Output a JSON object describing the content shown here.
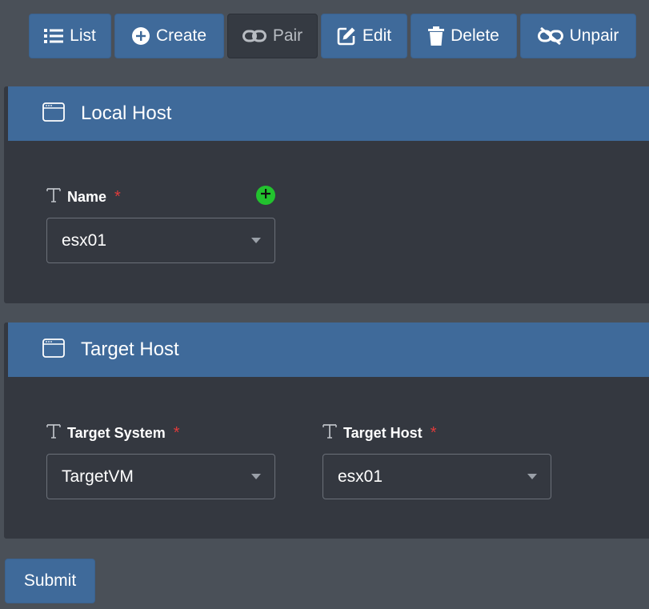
{
  "toolbar": {
    "list_label": "List",
    "create_label": "Create",
    "pair_label": "Pair",
    "edit_label": "Edit",
    "delete_label": "Delete",
    "unpair_label": "Unpair"
  },
  "local_host": {
    "title": "Local Host",
    "name_label": "Name",
    "name_required": "*",
    "name_value": "esx01"
  },
  "target_host": {
    "title": "Target Host",
    "system_label": "Target System",
    "system_required": "*",
    "system_value": "TargetVM",
    "host_label": "Target Host",
    "host_required": "*",
    "host_value": "esx01"
  },
  "submit_label": "Submit",
  "colors": {
    "accent": "#3f6a9a",
    "panel_bg": "#343840",
    "page_bg": "#4a5058",
    "required": "#e03b3b",
    "add_badge": "#22c22e"
  },
  "icons": {
    "list": "list-icon",
    "create": "plus-circle-icon",
    "pair": "link-icon",
    "edit": "edit-icon",
    "delete": "trash-icon",
    "unpair": "unlink-icon",
    "panel": "window-icon",
    "text_field": "text-type-icon",
    "add": "plus-icon"
  }
}
